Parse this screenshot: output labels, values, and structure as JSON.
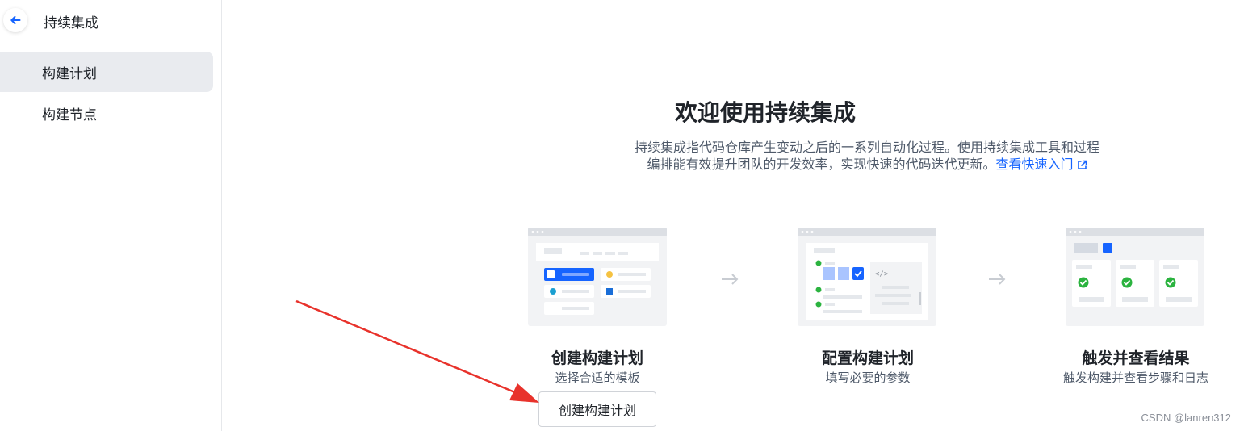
{
  "sidebar": {
    "title": "持续集成",
    "items": [
      {
        "label": "构建计划",
        "active": true
      },
      {
        "label": "构建节点",
        "active": false
      }
    ]
  },
  "main": {
    "title": "欢迎使用持续集成",
    "description_line1": "持续集成指代码仓库产生变动之后的一系列自动化过程。使用持续集成工具和过程",
    "description_line2": "编排能有效提升团队的开发效率，实现快速的代码迭代更新。",
    "quick_link": "查看快速入门",
    "steps": [
      {
        "title": "创建构建计划",
        "subtitle": "选择合适的模板"
      },
      {
        "title": "配置构建计划",
        "subtitle": "填写必要的参数"
      },
      {
        "title": "触发并查看结果",
        "subtitle": "触发构建并查看步骤和日志"
      }
    ],
    "create_button": "创建构建计划"
  },
  "watermark": "CSDN @lanren312",
  "colors": {
    "accent": "#1664ff",
    "success": "#2bb33f",
    "annotation_arrow": "#e8322b",
    "active_bg": "#e9ebef"
  },
  "icons": {
    "back": "arrow-left-icon",
    "external": "external-link-icon",
    "step_arrow": "arrow-right-icon"
  }
}
